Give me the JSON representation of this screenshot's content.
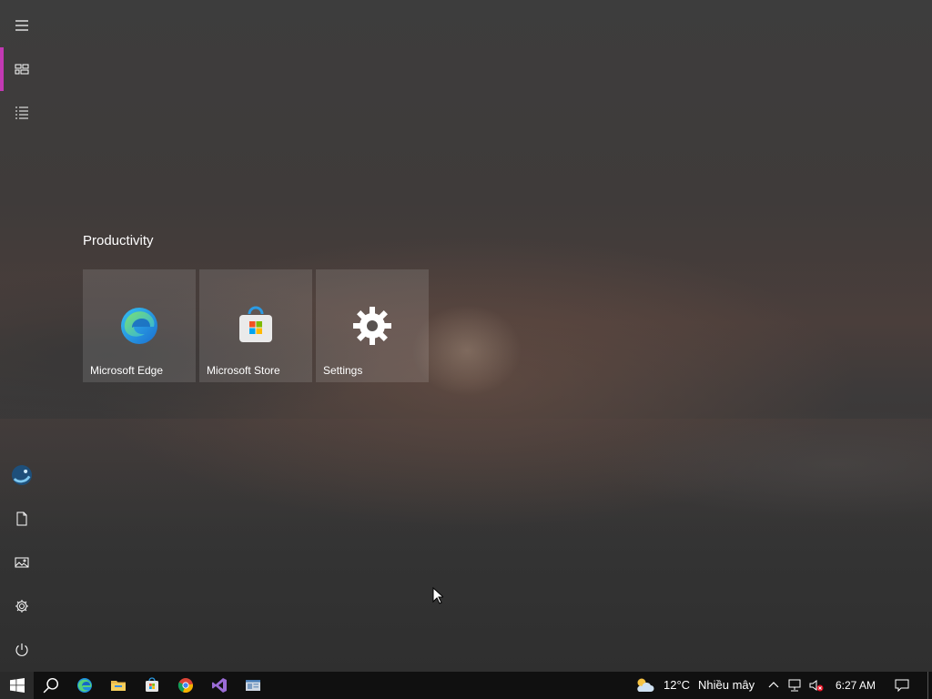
{
  "start_menu": {
    "group_title": "Productivity",
    "tiles": [
      {
        "label": "Microsoft Edge",
        "icon": "edge-icon"
      },
      {
        "label": "Microsoft Store",
        "icon": "store-icon"
      },
      {
        "label": "Settings",
        "icon": "gear-icon"
      }
    ],
    "rail": {
      "top": [
        "hamburger-icon",
        "pinned-tiles-icon",
        "all-apps-icon"
      ],
      "bottom": [
        "user-avatar",
        "documents-icon",
        "pictures-icon",
        "settings-icon",
        "power-icon"
      ]
    },
    "accent_color": "#c239b3"
  },
  "taskbar": {
    "pinned": [
      "start-button",
      "search-button",
      "edge-icon",
      "file-explorer-icon",
      "store-icon",
      "chrome-icon",
      "visual-studio-icon",
      "app-window-icon"
    ],
    "weather": {
      "temp": "12°C",
      "condition": "Nhiều mây",
      "icon": "cloud-sun-icon"
    },
    "tray_icons": [
      "chevron-up-icon",
      "network-icon",
      "volume-muted-icon"
    ],
    "clock": "6:27 AM",
    "notification_icon": "action-center-icon"
  }
}
